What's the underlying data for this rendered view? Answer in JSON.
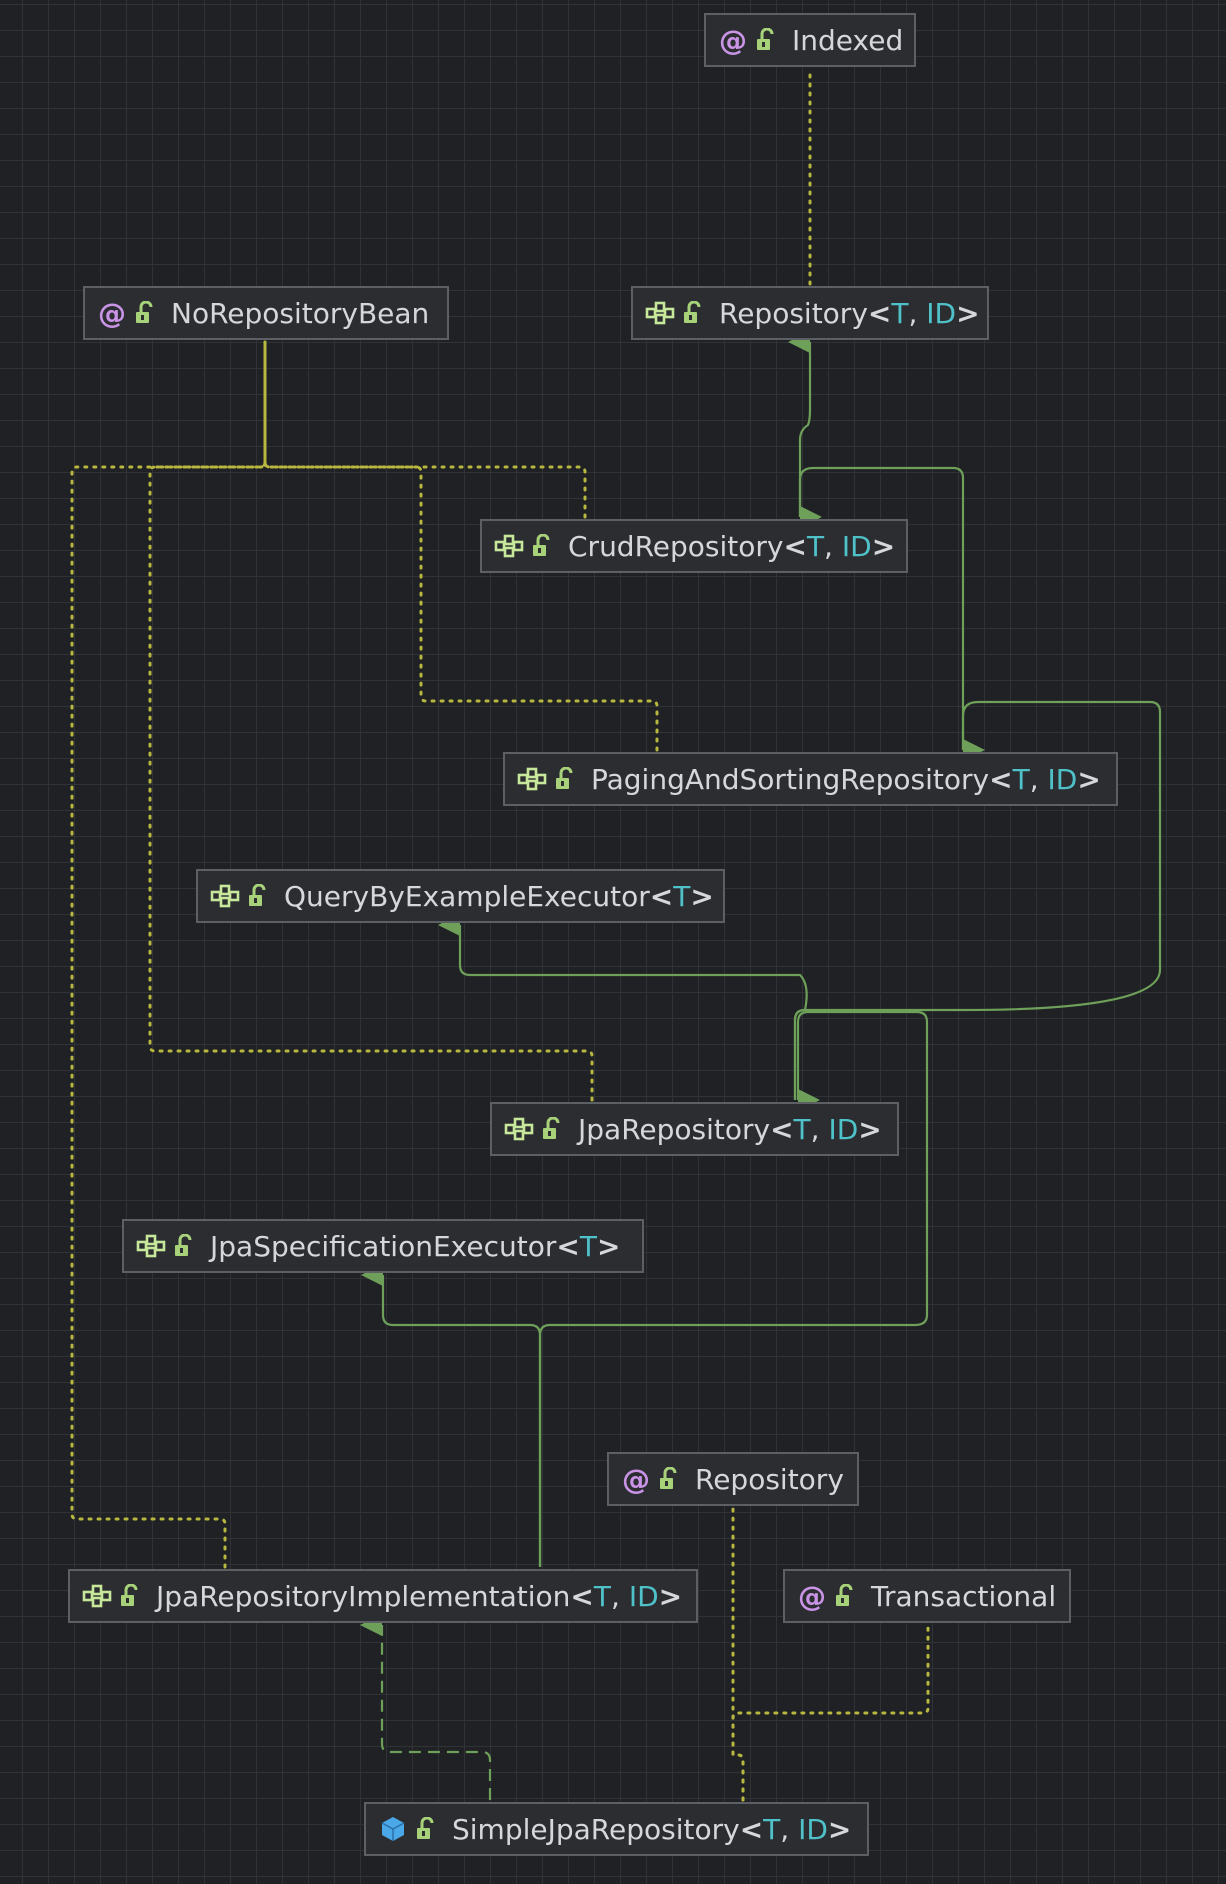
{
  "title": "",
  "colors": {
    "background": "#1f2124",
    "grid": "#303236",
    "node_bg": "#2b2d31",
    "node_border": "#5c5f64",
    "text": "#d5d7da",
    "type_param": "#4fc1c9",
    "annotation_icon": "#c993e6",
    "interface_icon": "#c7e89b",
    "class_icon": "#4aa8e8",
    "lock_icon": "#a8d27a",
    "inherit_edge": "#6ea05a",
    "annotation_edge": "#b8b840"
  },
  "nodes": [
    {
      "id": "indexed",
      "kind": "annotation",
      "name": "Indexed",
      "params": []
    },
    {
      "id": "norepositorybean",
      "kind": "annotation",
      "name": "NoRepositoryBean",
      "params": []
    },
    {
      "id": "repository_generic",
      "kind": "interface",
      "name": "Repository",
      "params": [
        "T",
        "ID"
      ]
    },
    {
      "id": "crudrepository",
      "kind": "interface",
      "name": "CrudRepository",
      "params": [
        "T",
        "ID"
      ]
    },
    {
      "id": "pagingandsortingrepository",
      "kind": "interface",
      "name": "PagingAndSortingRepository",
      "params": [
        "T",
        "ID"
      ]
    },
    {
      "id": "querybyexampleexecutor",
      "kind": "interface",
      "name": "QueryByExampleExecutor",
      "params": [
        "T"
      ]
    },
    {
      "id": "jparepository",
      "kind": "interface",
      "name": "JpaRepository",
      "params": [
        "T",
        "ID"
      ]
    },
    {
      "id": "jpaspecificationexecutor",
      "kind": "interface",
      "name": "JpaSpecificationExecutor",
      "params": [
        "T"
      ]
    },
    {
      "id": "repository_annotation",
      "kind": "annotation",
      "name": "Repository",
      "params": []
    },
    {
      "id": "jparepositoryimplementation",
      "kind": "interface",
      "name": "JpaRepositoryImplementation",
      "params": [
        "T",
        "ID"
      ]
    },
    {
      "id": "transactional",
      "kind": "annotation",
      "name": "Transactional",
      "params": []
    },
    {
      "id": "simplejparepository",
      "kind": "class",
      "name": "SimpleJpaRepository",
      "params": [
        "T",
        "ID"
      ]
    }
  ],
  "edges": [
    {
      "from": "repository_generic",
      "to": "indexed",
      "type": "annotation"
    },
    {
      "from": "crudrepository",
      "to": "norepositorybean",
      "type": "annotation"
    },
    {
      "from": "pagingandsortingrepository",
      "to": "norepositorybean",
      "type": "annotation"
    },
    {
      "from": "jparepository",
      "to": "norepositorybean",
      "type": "annotation"
    },
    {
      "from": "jparepositoryimplementation",
      "to": "norepositorybean",
      "type": "annotation"
    },
    {
      "from": "crudrepository",
      "to": "repository_generic",
      "type": "extends"
    },
    {
      "from": "pagingandsortingrepository",
      "to": "crudrepository",
      "type": "extends"
    },
    {
      "from": "jparepository",
      "to": "pagingandsortingrepository",
      "type": "extends"
    },
    {
      "from": "jparepository",
      "to": "querybyexampleexecutor",
      "type": "extends"
    },
    {
      "from": "jparepositoryimplementation",
      "to": "jparepository",
      "type": "extends"
    },
    {
      "from": "jparepositoryimplementation",
      "to": "jpaspecificationexecutor",
      "type": "extends"
    },
    {
      "from": "simplejparepository",
      "to": "jparepositoryimplementation",
      "type": "implements"
    },
    {
      "from": "simplejparepository",
      "to": "repository_annotation",
      "type": "annotation"
    },
    {
      "from": "simplejparepository",
      "to": "transactional",
      "type": "annotation"
    }
  ]
}
